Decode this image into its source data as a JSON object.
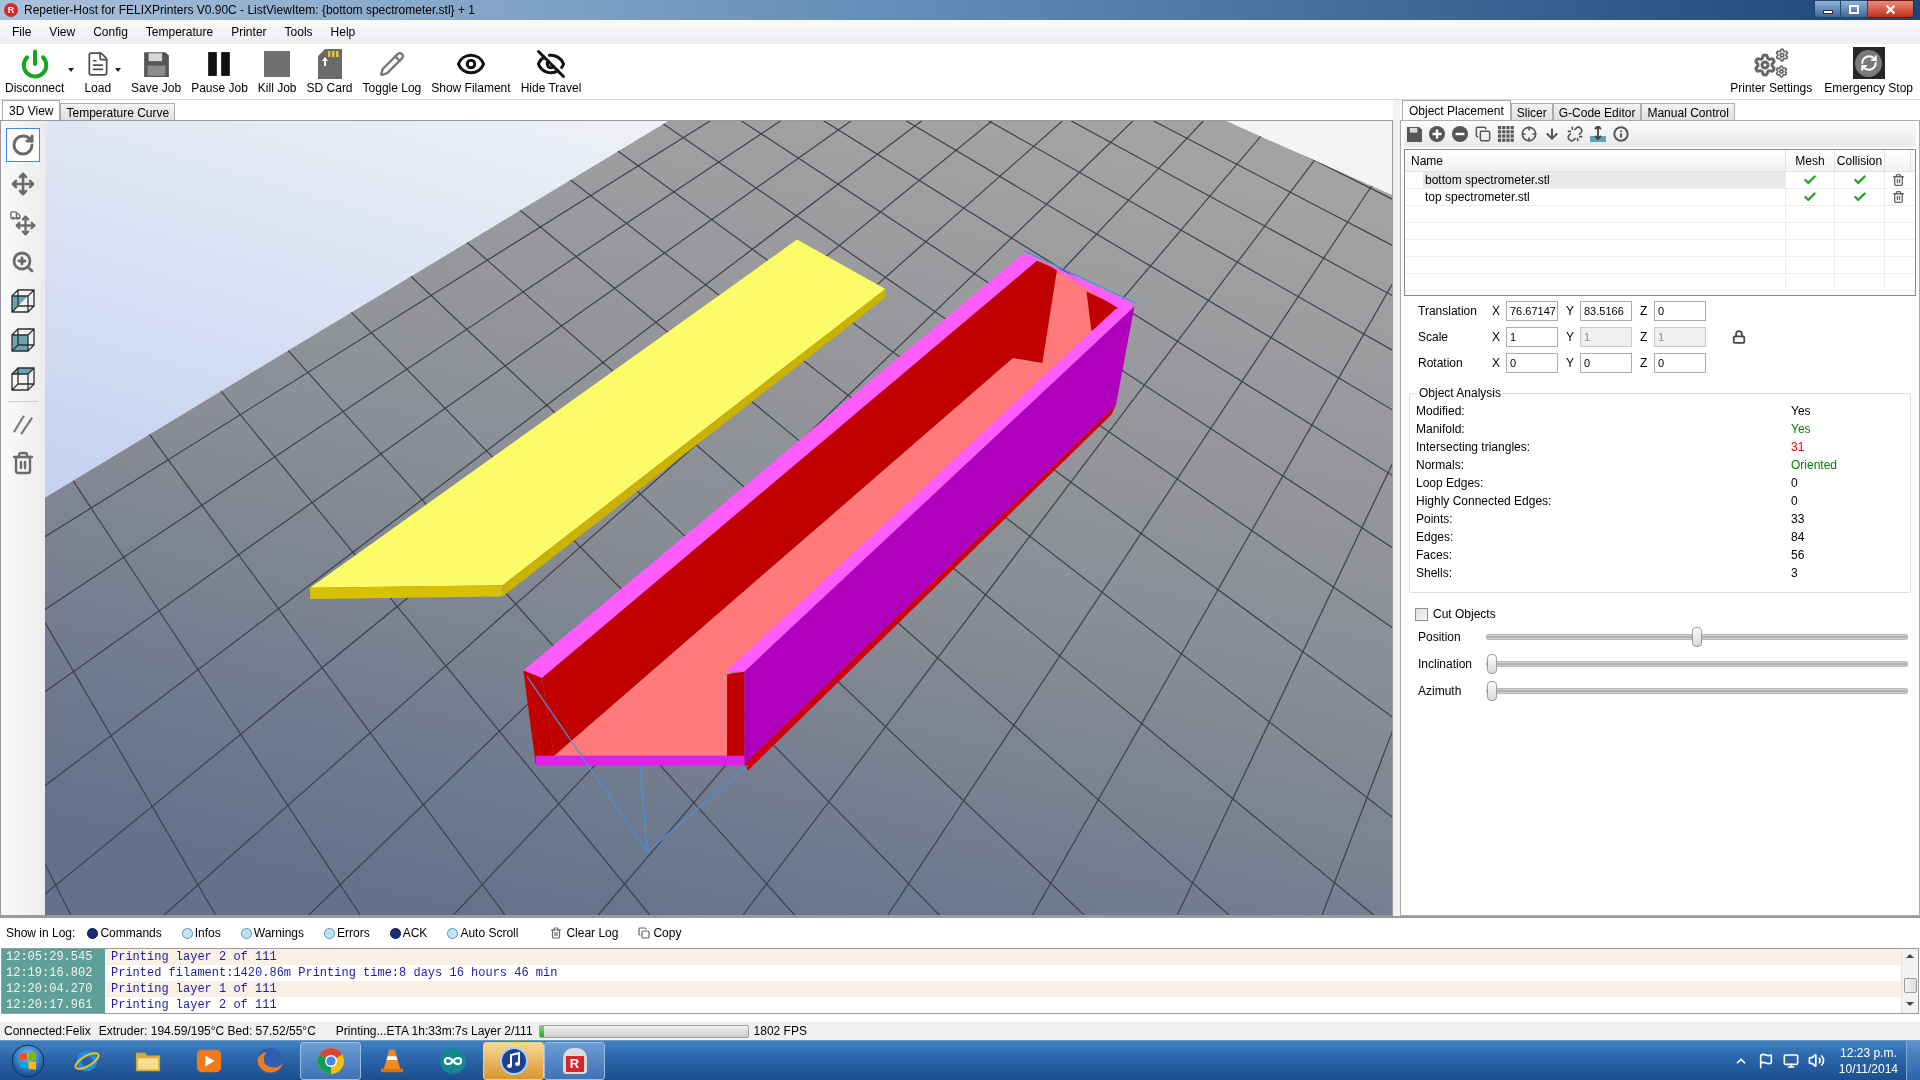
{
  "window": {
    "icon_letter": "R",
    "title": "Repetier-Host for FELIXPrinters V0.90C - ListViewItem: {bottom spectrometer.stl} + 1"
  },
  "menu": [
    "File",
    "View",
    "Config",
    "Temperature",
    "Printer",
    "Tools",
    "Help"
  ],
  "toolbar": {
    "left": [
      {
        "label": "Disconnect",
        "dropdown": true
      },
      {
        "label": "Load",
        "dropdown": true
      },
      {
        "label": "Save Job",
        "dropdown": false
      },
      {
        "label": "Pause Job",
        "dropdown": false
      },
      {
        "label": "Kill Job",
        "dropdown": false
      },
      {
        "label": "SD Card",
        "dropdown": false
      },
      {
        "label": "Toggle Log",
        "dropdown": false
      },
      {
        "label": "Show Filament",
        "dropdown": false
      },
      {
        "label": "Hide Travel",
        "dropdown": false
      }
    ],
    "right": [
      {
        "label": "Printer Settings"
      },
      {
        "label": "Emergency Stop"
      }
    ]
  },
  "view_tabs": [
    {
      "label": "3D View",
      "selected": true
    },
    {
      "label": "Temperature Curve",
      "selected": false
    }
  ],
  "view_tools": [
    {
      "selected": true
    },
    {
      "selected": false
    },
    {
      "selected": false
    },
    {
      "selected": false
    },
    {
      "selected": false
    },
    {
      "selected": false
    },
    {
      "selected": false
    },
    {
      "selected": false
    },
    {
      "selected": false
    }
  ],
  "side_tabs": [
    {
      "label": "Object Placement",
      "selected": true
    },
    {
      "label": "Slicer",
      "selected": false
    },
    {
      "label": "G-Code Editor",
      "selected": false
    },
    {
      "label": "Manual Control",
      "selected": false
    }
  ],
  "objects_table": {
    "columns": [
      "Name",
      "Mesh",
      "Collision"
    ],
    "rows": [
      {
        "name": "bottom spectrometer.stl",
        "selected": true,
        "mesh_ok": true,
        "collision_ok": true
      },
      {
        "name": "top spectrometer.stl",
        "selected": false,
        "mesh_ok": true,
        "collision_ok": true
      }
    ]
  },
  "transform": [
    {
      "label": "Translation",
      "fields": [
        {
          "axis": "X",
          "value": "76.67147",
          "disabled": false
        },
        {
          "axis": "Y",
          "value": "83.5166",
          "disabled": false
        },
        {
          "axis": "Z",
          "value": "0",
          "disabled": false
        }
      ]
    },
    {
      "label": "Scale",
      "locked": true,
      "fields": [
        {
          "axis": "X",
          "value": "1",
          "disabled": false
        },
        {
          "axis": "Y",
          "value": "1",
          "disabled": true
        },
        {
          "axis": "Z",
          "value": "1",
          "disabled": true
        }
      ]
    },
    {
      "label": "Rotation",
      "fields": [
        {
          "axis": "X",
          "value": "0",
          "disabled": false
        },
        {
          "axis": "Y",
          "value": "0",
          "disabled": false
        },
        {
          "axis": "Z",
          "value": "0",
          "disabled": false
        }
      ]
    }
  ],
  "object_analysis": {
    "title": "Object Analysis",
    "rows": [
      {
        "label": "Modified:",
        "value": "Yes"
      },
      {
        "label": "Manifold:",
        "value": "Yes",
        "color": "#008000"
      },
      {
        "label": "Intersecting triangles:",
        "value": "31",
        "color": "#ff0000"
      },
      {
        "label": "Normals:",
        "value": "Oriented",
        "color": "#008000"
      },
      {
        "label": "Loop Edges:",
        "value": "0"
      },
      {
        "label": "Highly Connected Edges:",
        "value": "0"
      },
      {
        "label": "Points:",
        "value": "33"
      },
      {
        "label": "Edges:",
        "value": "84"
      },
      {
        "label": "Faces:",
        "value": "56"
      },
      {
        "label": "Shells:",
        "value": "3"
      }
    ]
  },
  "cut": {
    "label": "Cut Objects",
    "checked": false,
    "sliders": [
      {
        "label": "Position",
        "level": 0.5
      },
      {
        "label": "Inclination",
        "level": 0
      },
      {
        "label": "Azimuth",
        "level": 0
      }
    ]
  },
  "log": {
    "label": "Show in Log:",
    "filters": [
      {
        "label": "Commands",
        "on": true
      },
      {
        "label": "Infos",
        "on": false
      },
      {
        "label": "Warnings",
        "on": false
      },
      {
        "label": "Errors",
        "on": false
      },
      {
        "label": "ACK",
        "on": true
      },
      {
        "label": "Auto Scroll",
        "on": false
      }
    ],
    "actions": [
      "Clear Log",
      "Copy"
    ],
    "lines": [
      {
        "time": "12:05:29.545",
        "text": "Printing layer 2 of 111"
      },
      {
        "time": "12:19:16.802",
        "text": "Printed filament:1420.86m Printing time:8 days 16 hours 46 min"
      },
      {
        "time": "12:20:04.270",
        "text": "Printing layer 1 of 111"
      },
      {
        "time": "12:20:17.961",
        "text": "Printing layer 2 of 111"
      }
    ]
  },
  "status_bar": {
    "connection": "Connected:Felix",
    "temperatures": "Extruder: 194.59/195°C Bed: 57.52/55°C",
    "job": "Printing...ETA 1h:33m:7s Layer 2/111",
    "progress": {
      "level": 0.02
    },
    "fps": "1802 FPS"
  },
  "taskbar": {
    "apps": [
      {
        "running": false,
        "highlighted": false
      },
      {
        "running": false,
        "highlighted": false
      },
      {
        "running": false,
        "highlighted": false
      },
      {
        "running": false,
        "highlighted": false
      },
      {
        "running": true,
        "highlighted": false
      },
      {
        "running": false,
        "highlighted": false
      },
      {
        "running": false,
        "highlighted": false
      },
      {
        "running": true,
        "highlighted": true
      },
      {
        "running": true,
        "highlighted": false,
        "letter": "R"
      }
    ],
    "clock": {
      "time": "12:23 p.m.",
      "date": "10/11/2014"
    }
  }
}
